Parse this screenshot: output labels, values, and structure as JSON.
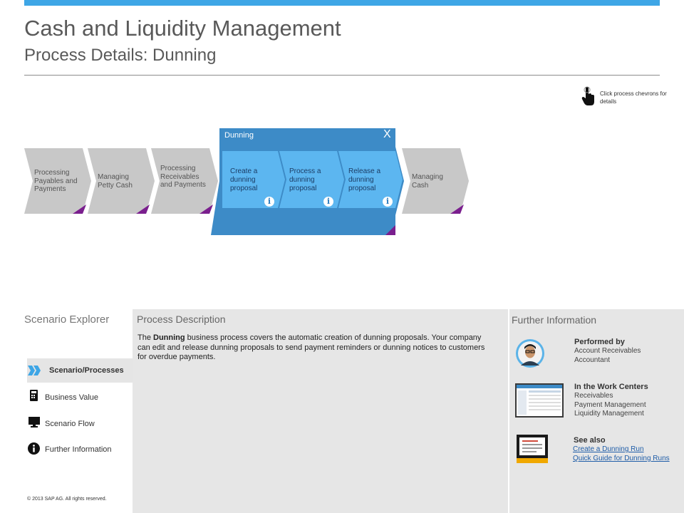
{
  "header": {
    "title": "Cash and Liquidity Management",
    "subtitle": "Process Details: Dunning"
  },
  "hint": {
    "text": "Click process chevrons for details",
    "icon": "hand-pointer-icon"
  },
  "process_flow": {
    "chevrons": [
      {
        "label": "Processing Payables and Payments"
      },
      {
        "label": "Managing Petty Cash"
      },
      {
        "label": "Processing Receivables and Payments"
      },
      {
        "label": "Managing Cash"
      }
    ],
    "expanded": {
      "label": "Dunning",
      "close_label": "X",
      "steps": [
        {
          "label": "Create a dunning proposal",
          "info": "i"
        },
        {
          "label": "Process a dunning proposal",
          "info": "i"
        },
        {
          "label": "Release a dunning proposal",
          "info": "i"
        }
      ]
    },
    "colors": {
      "chevron_gray": "#c8c8c8",
      "expanded_blue": "#3d8bc7",
      "step_blue": "#5cb6f0",
      "corner_purple": "#7a1f8e",
      "accent_blue": "#3ea6e6"
    }
  },
  "scenario_explorer": {
    "title": "Scenario Explorer",
    "items": [
      {
        "label": "Scenario/Processes",
        "icon": "double-chevron-icon",
        "selected": true
      },
      {
        "label": "Business Value",
        "icon": "calculator-icon"
      },
      {
        "label": "Scenario Flow",
        "icon": "monitor-icon"
      },
      {
        "label": "Further Information",
        "icon": "info-icon"
      }
    ]
  },
  "process_description": {
    "title": "Process Description",
    "text_before": "The ",
    "text_bold": "Dunning",
    "text_after": " business process covers the automatic creation of dunning proposals. Your company can edit and release dunning proposals to send payment reminders or dunning notices to customers for overdue payments."
  },
  "further_information": {
    "title": "Further Information",
    "performed_by": {
      "heading": "Performed by",
      "lines": [
        "Account Receivables",
        "Accountant"
      ],
      "icon": "person-avatar-icon"
    },
    "work_centers": {
      "heading": "In the Work Centers",
      "lines": [
        "Receivables",
        "Payment Management",
        "Liquidity Management"
      ],
      "icon": "screen-thumbnail-icon"
    },
    "see_also": {
      "heading": "See also",
      "links": [
        "Create a Dunning Run",
        "Quick Guide for Dunning Runs"
      ],
      "icon": "document-monitor-icon"
    }
  },
  "footer": {
    "copyright": "© 2013 SAP AG. All rights reserved."
  }
}
